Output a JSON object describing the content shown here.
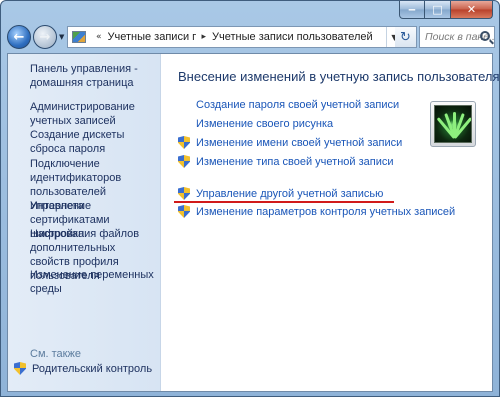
{
  "window": {
    "caption": {
      "minimize_icon": "minimize-icon",
      "maximize_icon": "maximize-icon",
      "close_icon": "close-icon"
    }
  },
  "nav": {
    "back_icon": "back-arrow-icon",
    "forward_icon": "forward-arrow-icon",
    "address": {
      "icon": "control-panel-icon",
      "segments": [
        "Учетные записи пол...",
        "Учетные записи пользователей"
      ]
    },
    "refresh_icon": "refresh-icon",
    "search_placeholder": "Поиск в пане..."
  },
  "sidebar": {
    "links": [
      "Панель управления - домашняя страница",
      "Администрирование учетных записей",
      "Создание дискеты сброса пароля",
      "Подключение идентификаторов пользователей Интернета",
      "Управление сертификатами шифрования файлов",
      "Настройка дополнительных свойств профиля пользователя",
      "Изменение переменных среды"
    ],
    "see_also_heading": "См. также",
    "see_also_link": "Родительский контроль"
  },
  "main": {
    "title": "Внесение изменений в учетную запись пользователя",
    "tasks": [
      {
        "label": "Создание пароля своей учетной записи",
        "shield": false
      },
      {
        "label": "Изменение своего рисунка",
        "shield": false
      },
      {
        "label": "Изменение имени своей учетной записи",
        "shield": true
      },
      {
        "label": "Изменение типа своей учетной записи",
        "shield": true
      }
    ],
    "other_tasks": [
      {
        "label": "Управление другой учетной записью",
        "shield": true,
        "highlighted": true
      },
      {
        "label": "Изменение параметров контроля учетных записей",
        "shield": true
      }
    ],
    "user_picture": "user-account-picture",
    "colors": {
      "link": "#1a56b8",
      "title": "#1e3a6b",
      "highlight_underline": "#d11a1a"
    }
  }
}
